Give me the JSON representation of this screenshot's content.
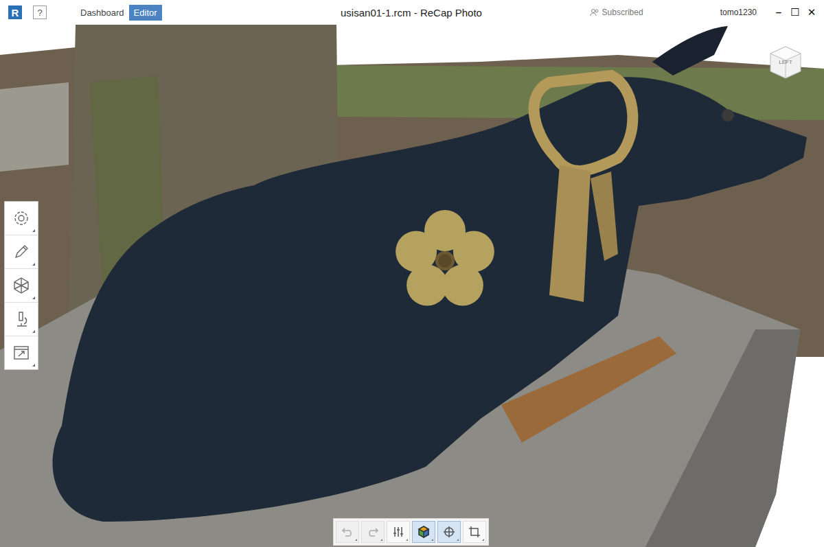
{
  "window": {
    "title": "usisan01-1.rcm - ReCap Photo",
    "logo": "R",
    "help": "?"
  },
  "nav_tabs": [
    {
      "label": "Dashboard",
      "selected": false
    },
    {
      "label": "Editor",
      "selected": true
    }
  ],
  "subscription": "Subscribed",
  "user": "tomo1230",
  "window_controls": [
    "–",
    "☐",
    "✕"
  ],
  "view_cube": {
    "label": "LEFT"
  },
  "bottom_toolbar": [
    {
      "selected": false,
      "disabled": true
    },
    {
      "selected": false,
      "disabled": true
    },
    {
      "selected": false,
      "disabled": false
    },
    {
      "selected": true,
      "disabled": false
    },
    {
      "selected": true,
      "disabled": false
    },
    {
      "selected": false,
      "disabled": false
    }
  ]
}
